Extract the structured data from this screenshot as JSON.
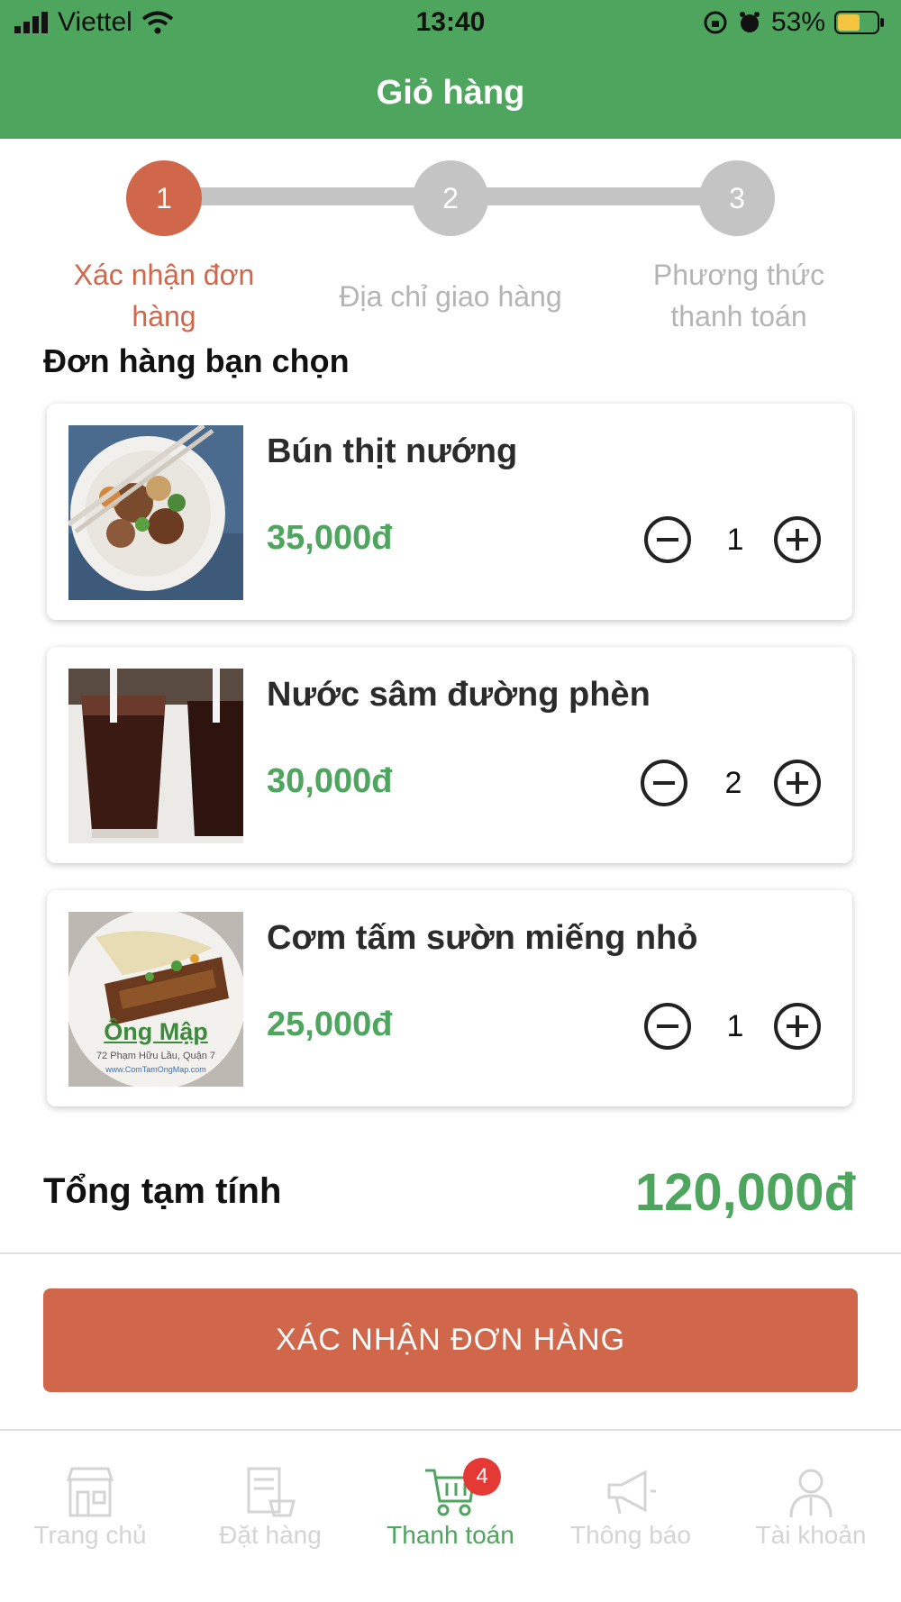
{
  "status_bar": {
    "carrier": "Viettel",
    "time": "13:40",
    "battery": "53%"
  },
  "header": {
    "title": "Giỏ hàng"
  },
  "steps": [
    {
      "number": "1",
      "label": "Xác nhận đơn hàng",
      "active": true
    },
    {
      "number": "2",
      "label": "Địa chỉ giao hàng",
      "active": false
    },
    {
      "number": "3",
      "label": "Phương thức thanh toán",
      "active": false
    }
  ],
  "section_title": "Đơn hàng bạn chọn",
  "items": [
    {
      "name": "Bún thịt nướng",
      "price": "35,000đ",
      "quantity": "1"
    },
    {
      "name": "Nước sâm đường phèn",
      "price": "30,000đ",
      "quantity": "2"
    },
    {
      "name": "Cơm tấm sườn miếng nhỏ",
      "price": "25,000đ",
      "quantity": "1",
      "image_text": {
        "brand": "Ông Mập",
        "address": "72 Phạm Hữu Lầu, Quận 7",
        "website": "www.ComTamOngMap.com"
      }
    }
  ],
  "total": {
    "label": "Tổng tạm tính",
    "value": "120,000đ"
  },
  "confirm_button": {
    "label": "XÁC NHẬN ĐƠN HÀNG"
  },
  "tabbar": {
    "tabs": [
      {
        "label": "Trang chủ",
        "icon": "store-icon"
      },
      {
        "label": "Đặt hàng",
        "icon": "order-icon"
      },
      {
        "label": "Thanh toán",
        "icon": "cart-icon",
        "active": true,
        "badge": "4"
      },
      {
        "label": "Thông báo",
        "icon": "megaphone-icon"
      },
      {
        "label": "Tài khoản",
        "icon": "user-icon"
      }
    ]
  },
  "colors": {
    "primary_green": "#4ea55e",
    "accent_orange": "#d0674b",
    "inactive_gray": "#c4c4c4",
    "badge_red": "#e53935"
  }
}
